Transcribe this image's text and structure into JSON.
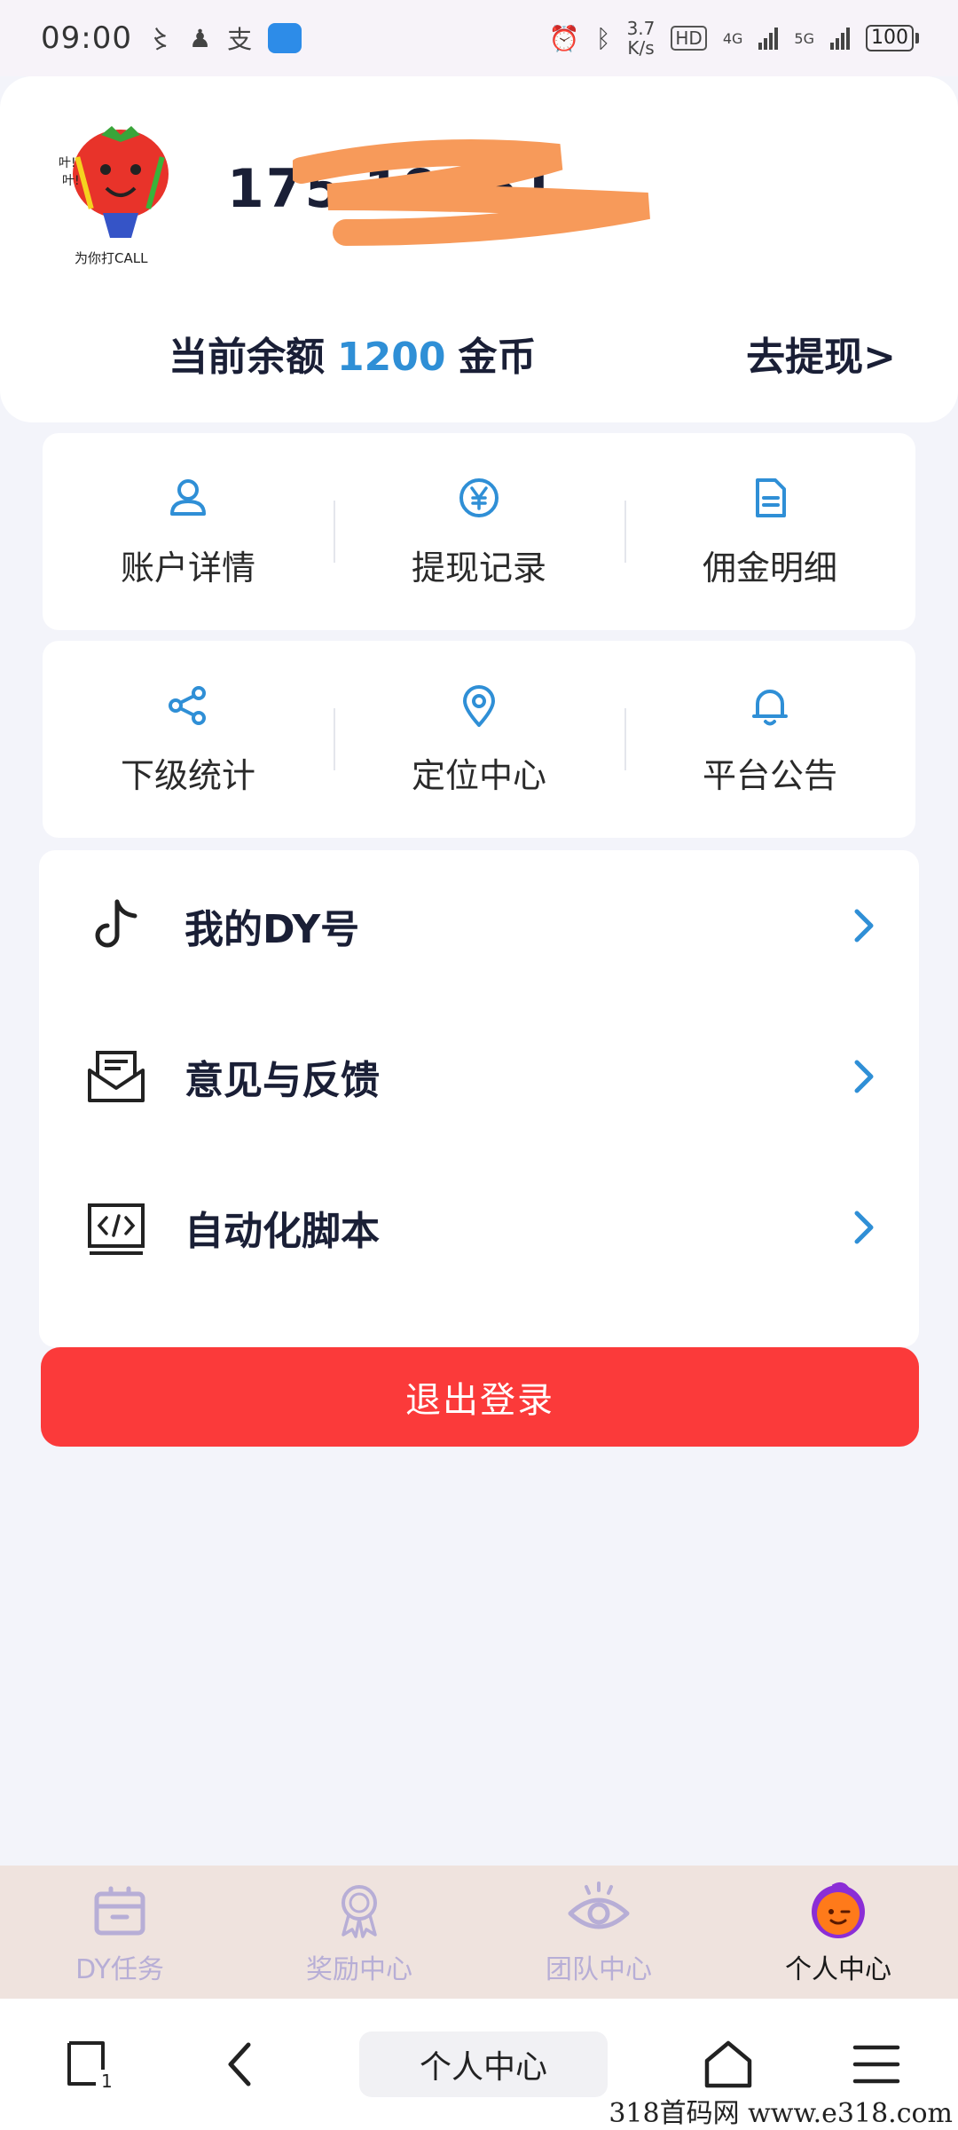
{
  "status_bar": {
    "time": "09:00",
    "speed_value": "3.7",
    "speed_unit": "K/s",
    "hd": "HD",
    "net1": "4G",
    "net2": "5G",
    "battery": "100"
  },
  "profile": {
    "username": "175   19061",
    "balance_label": "当前余额",
    "balance_amount": "1200",
    "balance_unit": "金币",
    "withdraw_link": "去提现>"
  },
  "grid_row1": [
    {
      "label": "账户详情",
      "icon": "user-icon"
    },
    {
      "label": "提现记录",
      "icon": "yen-icon"
    },
    {
      "label": "佣金明细",
      "icon": "document-icon"
    }
  ],
  "grid_row2": [
    {
      "label": "下级统计",
      "icon": "share-icon"
    },
    {
      "label": "定位中心",
      "icon": "location-pin-icon"
    },
    {
      "label": "平台公告",
      "icon": "bell-icon"
    }
  ],
  "menu": [
    {
      "label": "我的DY号",
      "icon": "tiktok-icon"
    },
    {
      "label": "意见与反馈",
      "icon": "mail-icon"
    },
    {
      "label": "自动化脚本",
      "icon": "code-icon"
    }
  ],
  "logout_label": "退出登录",
  "tabs": [
    {
      "label": "DY任务",
      "icon": "gift-box-icon",
      "active": false
    },
    {
      "label": "奖励中心",
      "icon": "medal-icon",
      "active": false
    },
    {
      "label": "团队中心",
      "icon": "eye-icon",
      "active": false
    },
    {
      "label": "个人中心",
      "icon": "avatar-face-icon",
      "active": true
    }
  ],
  "nav_bar": {
    "tabs_count": "1",
    "title": "个人中心"
  },
  "watermark": "318首码网  www.e318.com",
  "colors": {
    "accent": "#2f8fd6",
    "logout": "#fb3a3a",
    "tabbar_bg": "#efe3de",
    "tab_inactive": "#b7aed6"
  }
}
